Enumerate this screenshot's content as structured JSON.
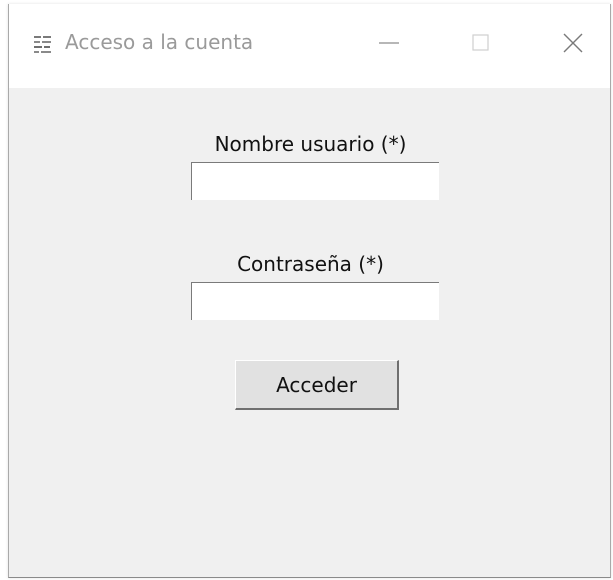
{
  "window": {
    "title": "Acceso a la cuenta",
    "icon": "window-app-icon",
    "controls": {
      "minimize_icon": "minimize-icon",
      "maximize_icon": "maximize-icon",
      "close_icon": "close-icon"
    }
  },
  "form": {
    "username_label": "Nombre usuario (*)",
    "username_value": "",
    "username_placeholder": "",
    "password_label": "Contraseña (*)",
    "password_value": "",
    "password_placeholder": "",
    "submit_label": "Acceder"
  },
  "colors": {
    "window_background": "#f0f0f0",
    "titlebar_background": "#ffffff",
    "title_text": "#9a9a9a",
    "input_background": "#ffffff",
    "button_background": "#e1e1e1"
  }
}
